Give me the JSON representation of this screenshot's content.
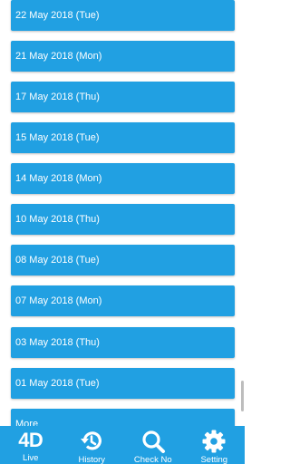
{
  "history": {
    "dates": [
      "22 May 2018 (Tue)",
      "21 May 2018 (Mon)",
      "17 May 2018 (Thu)",
      "15 May 2018 (Tue)",
      "14 May 2018 (Mon)",
      "10 May 2018 (Thu)",
      "08 May 2018 (Tue)",
      "07 May 2018 (Mon)",
      "03 May 2018 (Thu)",
      "01 May 2018 (Tue)"
    ],
    "more_label": "More"
  },
  "nav": {
    "items": [
      {
        "label": "Live",
        "icon": "4d-logo-icon",
        "icon_text": "4D"
      },
      {
        "label": "History",
        "icon": "history-icon"
      },
      {
        "label": "Check No",
        "icon": "search-icon"
      },
      {
        "label": "Setting",
        "icon": "gear-icon"
      }
    ]
  },
  "colors": {
    "accent": "#21a0e2",
    "text": "#ffffff",
    "background": "#ffffff"
  }
}
